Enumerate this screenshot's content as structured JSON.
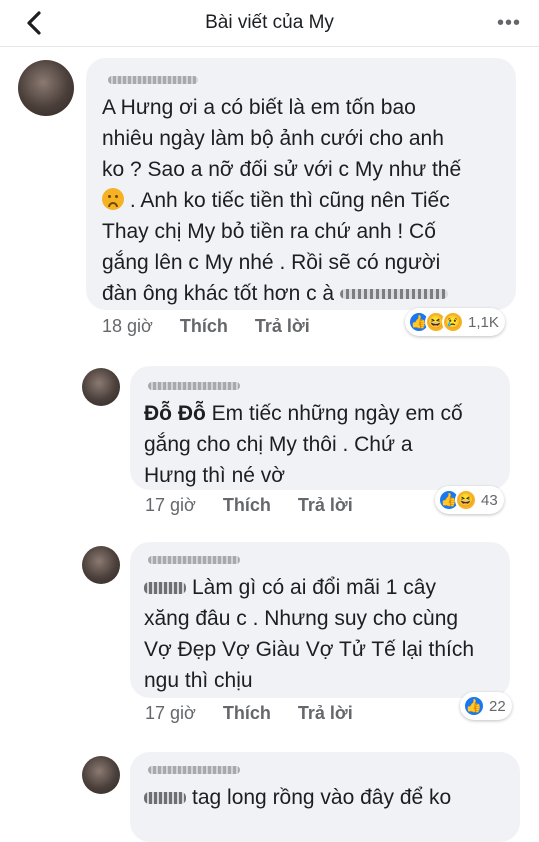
{
  "header": {
    "title": "Bài viết của My",
    "back_icon": "chevron-left-icon",
    "more_icon": "more-dots-icon"
  },
  "comments": [
    {
      "line_1": "A Hưng ơi a có biết là em tốn bao",
      "line_2": "nhiêu ngày làm bộ ảnh cưới cho anh",
      "line_3": "ko ? Sao a nỡ đối sử với c My như thế",
      "line_4": ". Anh ko tiếc tiền thì cũng nên Tiếc",
      "line_5": "Thay chị My bỏ tiền ra chứ anh ! Cố",
      "line_6": "gắng lên c My nhé . Rồi sẽ có người",
      "line_7": "đàn ông khác tốt hơn c à",
      "time": "18 giờ",
      "like_label": "Thích",
      "reply_label": "Trả lời",
      "reaction_count": "1,1K"
    },
    {
      "mention": "Đỗ Đỗ",
      "line_1": "Em tiếc những ngày em cố",
      "line_2": "gắng cho chị My thôi . Chứ a",
      "line_3": "Hưng thì né vờ",
      "time": "17 giờ",
      "like_label": "Thích",
      "reply_label": "Trả lời",
      "reaction_count": "43"
    },
    {
      "line_1": "Làm gì có ai đổi mãi 1 cây",
      "line_2": "xăng đâu c . Nhưng suy cho cùng",
      "line_3": "Vợ Đẹp Vợ Giàu Vợ Tử Tế lại thích",
      "line_4": "ngu thì chịu",
      "time": "17 giờ",
      "like_label": "Thích",
      "reply_label": "Trả lời",
      "reaction_count": "22"
    },
    {
      "line_1": "tag long rồng vào đây để ko"
    }
  ],
  "colors": {
    "bubble": "#f0f2f5",
    "meta_text": "#65676b",
    "like_blue": "#1877f2",
    "emoji_yellow": "#f7b125"
  }
}
